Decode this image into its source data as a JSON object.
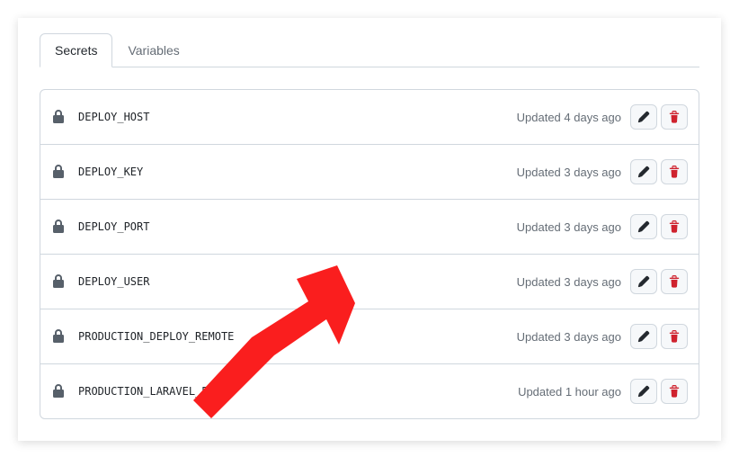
{
  "tabs": {
    "secrets": "Secrets",
    "variables": "Variables"
  },
  "secrets": [
    {
      "name": "DEPLOY_HOST",
      "updated": "Updated 4 days ago"
    },
    {
      "name": "DEPLOY_KEY",
      "updated": "Updated 3 days ago"
    },
    {
      "name": "DEPLOY_PORT",
      "updated": "Updated 3 days ago"
    },
    {
      "name": "DEPLOY_USER",
      "updated": "Updated 3 days ago"
    },
    {
      "name": "PRODUCTION_DEPLOY_REMOTE",
      "updated": "Updated 3 days ago"
    },
    {
      "name": "PRODUCTION_LARAVEL_ENV",
      "updated": "Updated 1 hour ago"
    }
  ]
}
